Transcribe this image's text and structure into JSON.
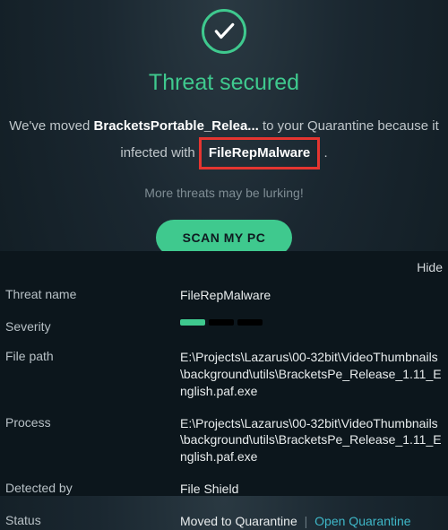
{
  "header": {
    "title": "Threat secured"
  },
  "message": {
    "prefix": "We've moved ",
    "filename": "BracketsPortable_Relea...",
    "middle": " to your Quarantine because it",
    "infected_prefix": "infected with ",
    "threat_name": "FileRepMalware",
    "period": "."
  },
  "subtext": "More threats may be lurking!",
  "scan_button": "SCAN MY PC",
  "hide_label": "Hide",
  "details": {
    "threat_name": {
      "label": "Threat name",
      "value": "FileRepMalware"
    },
    "severity": {
      "label": "Severity",
      "level": 1
    },
    "file_path": {
      "label": "File path",
      "value": "E:\\Projects\\Lazarus\\00-32bit\\VideoThumbnails\\background\\utils\\BracketsPe_Release_1.11_English.paf.exe"
    },
    "process": {
      "label": "Process",
      "value": "E:\\Projects\\Lazarus\\00-32bit\\VideoThumbnails\\background\\utils\\BracketsPe_Release_1.11_English.paf.exe"
    },
    "detected_by": {
      "label": "Detected by",
      "value": "File Shield"
    },
    "status": {
      "label": "Status",
      "moved": "Moved to Quarantine",
      "sep": "|",
      "link": "Open Quarantine"
    }
  }
}
